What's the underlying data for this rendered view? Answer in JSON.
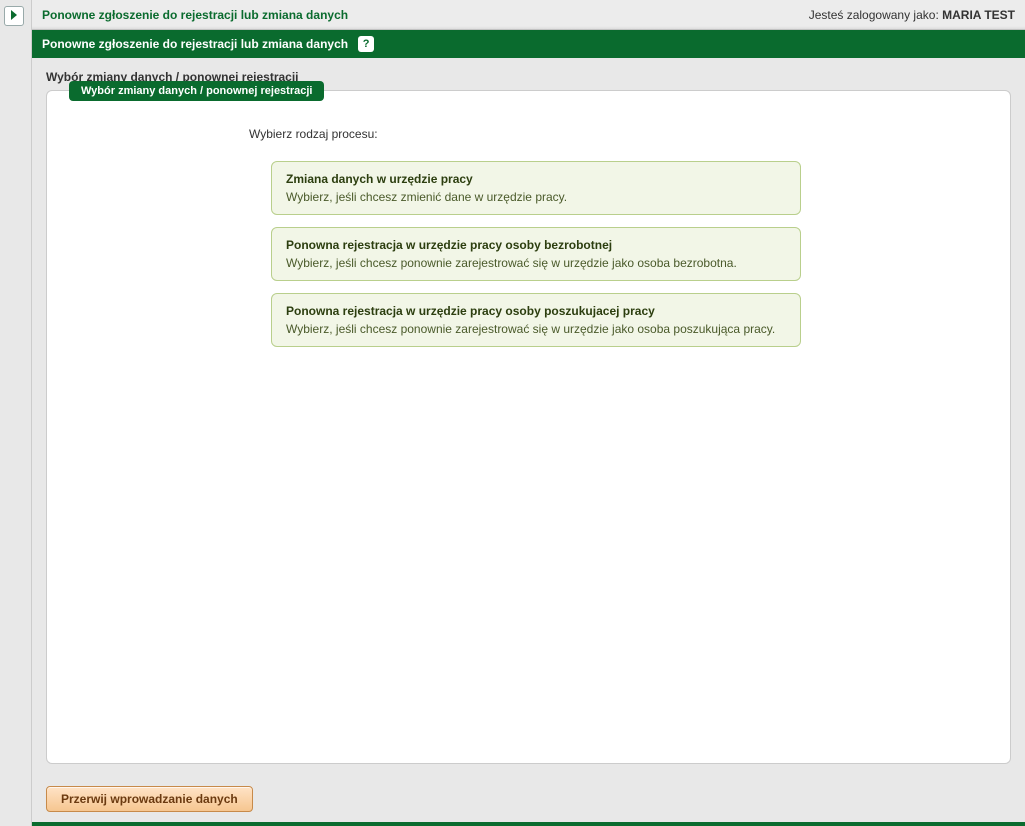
{
  "header": {
    "breadcrumb": "Ponowne zgłoszenie do rejestracji lub zmiana danych",
    "login_prefix": "Jesteś zalogowany jako: ",
    "login_user": "MARIA TEST"
  },
  "page": {
    "title": "Ponowne zgłoszenie do rejestracji lub zmiana danych",
    "help_symbol": "?",
    "subheader": "Wybór zmiany danych / ponownej rejestracji",
    "panel_title": "Wybór zmiany danych / ponownej rejestracji",
    "process_label": "Wybierz rodzaj procesu:"
  },
  "options": [
    {
      "title": "Zmiana danych w urzędzie pracy",
      "desc": "Wybierz, jeśli chcesz zmienić dane w urzędzie pracy."
    },
    {
      "title": "Ponowna rejestracja w urzędzie pracy osoby bezrobotnej",
      "desc": "Wybierz, jeśli chcesz ponownie zarejestrować się w urzędzie jako osoba bezrobotna."
    },
    {
      "title": "Ponowna rejestracja w urzędzie pracy osoby poszukujacej pracy",
      "desc": "Wybierz, jeśli chcesz ponownie zarejestrować się w urzędzie jako osoba poszukująca pracy."
    }
  ],
  "footer": {
    "cancel_label": "Przerwij wprowadzanie danych"
  }
}
